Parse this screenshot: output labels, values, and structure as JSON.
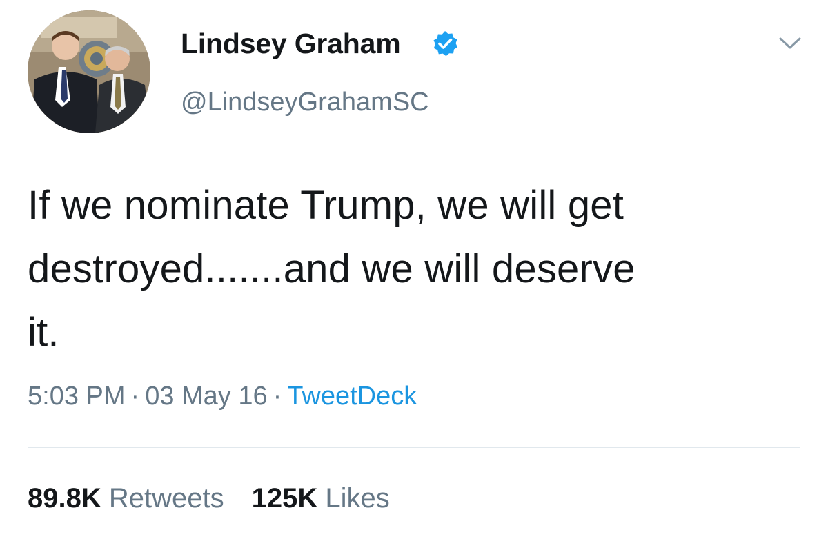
{
  "tweet": {
    "author": {
      "display_name": "Lindsey Graham",
      "handle": "@LindseyGrahamSC",
      "verified": true,
      "avatar_icon": "profile-photo"
    },
    "text_lines": [
      "If we nominate Trump, we will get",
      "destroyed.......and we will deserve",
      "it."
    ],
    "meta": {
      "time": "5:03 PM",
      "separator": "·",
      "date": "03 May 16",
      "source": "TweetDeck"
    },
    "stats": {
      "retweets_count": "89.8K",
      "retweets_label": "Retweets",
      "likes_count": "125K",
      "likes_label": "Likes"
    },
    "menu_icon": "chevron-down-icon"
  },
  "colors": {
    "text_primary": "#14171a",
    "text_secondary": "#657786",
    "link_blue": "#1b95e0",
    "verified_blue": "#1da1f2",
    "divider": "#e1e8ed"
  }
}
